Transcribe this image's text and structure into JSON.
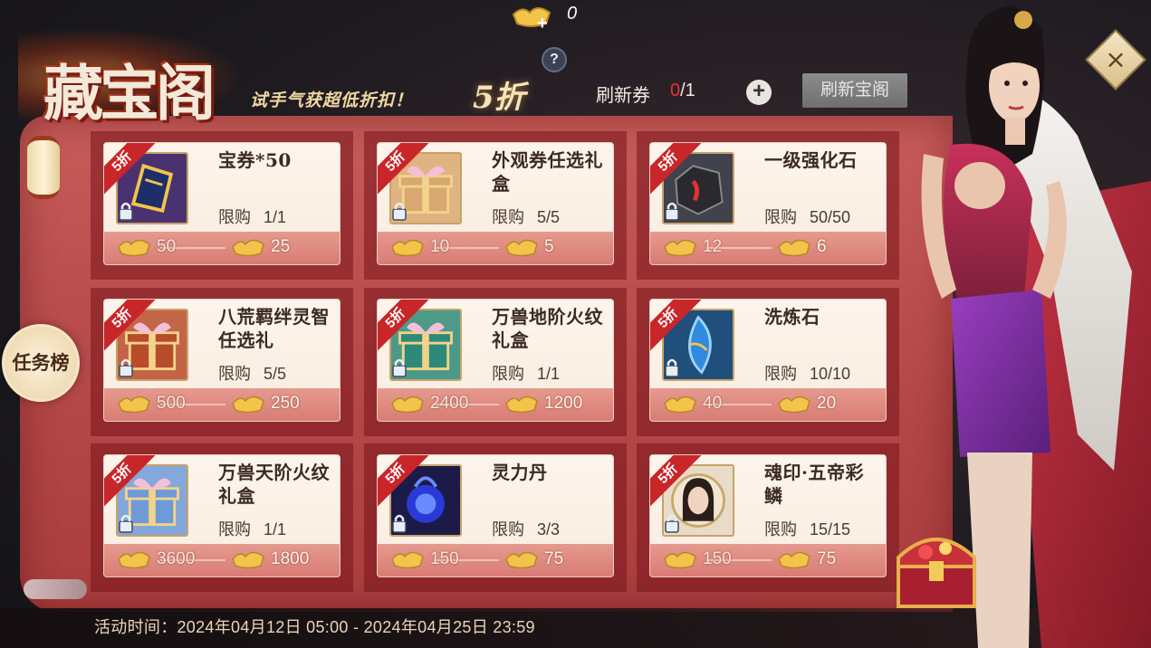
{
  "header": {
    "title": "藏宝阁",
    "subtitle": "试手气获超低折扣！",
    "discount": "5折",
    "gold_balance": "0",
    "help": "?",
    "refresh_ticket_label": "刷新券",
    "refresh_ticket_current": "0",
    "refresh_ticket_max": "/1",
    "plus": "+",
    "refresh_button": "刷新宝阁",
    "close": "×"
  },
  "side": {
    "task_button": "任务榜"
  },
  "footer": {
    "event_time": "活动时间：2024年04月12日 05:00 - 2024年04月25日 23:59"
  },
  "ribbon_label": "5折",
  "limit_label": "限购",
  "items": [
    {
      "name": "宝券*50",
      "limit": "1/1",
      "orig_price": "50",
      "price": "25",
      "icon": "coupon-icon",
      "color": "#5a3a8a"
    },
    {
      "name": "外观券任选礼盒",
      "limit": "5/5",
      "orig_price": "10",
      "price": "5",
      "icon": "gift-box-icon",
      "color": "#d9a870"
    },
    {
      "name": "一级强化石",
      "limit": "50/50",
      "orig_price": "12",
      "price": "6",
      "icon": "stone-icon",
      "color": "#3a3a40"
    },
    {
      "name": "八荒羁绊灵智任选礼",
      "limit": "5/5",
      "orig_price": "500",
      "price": "250",
      "icon": "gift-box-icon",
      "color": "#b84b2a"
    },
    {
      "name": "万兽地阶火纹礼盒",
      "limit": "1/1",
      "orig_price": "2400",
      "price": "1200",
      "icon": "gift-box-icon",
      "color": "#2e8a78"
    },
    {
      "name": "洗炼石",
      "limit": "10/10",
      "orig_price": "40",
      "price": "20",
      "icon": "crystal-icon",
      "color": "#2a6db0"
    },
    {
      "name": "万兽天阶火纹礼盒",
      "limit": "1/1",
      "orig_price": "3600",
      "price": "1800",
      "icon": "gift-box-icon",
      "color": "#6f9ad8"
    },
    {
      "name": "灵力丹",
      "limit": "3/3",
      "orig_price": "150",
      "price": "75",
      "icon": "pill-icon",
      "color": "#2a2a8a"
    },
    {
      "name": "魂印·五帝彩鳞",
      "limit": "15/15",
      "orig_price": "150",
      "price": "75",
      "icon": "portrait-icon",
      "color": "#d8c8b0"
    }
  ]
}
